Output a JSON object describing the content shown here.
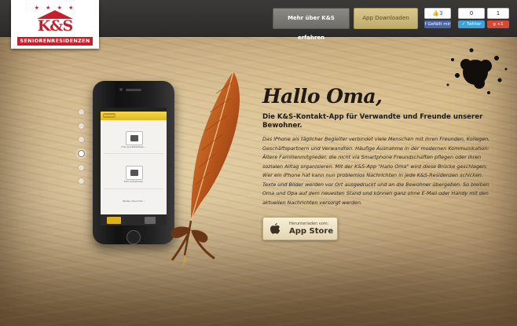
{
  "header": {
    "logo": {
      "mark": "K&S",
      "subtitle": "SENIORENRESIDENZEN",
      "stars": "★ ★ ★ ★"
    },
    "more_button": "Mehr über K&S erfahren",
    "app_button": "App Downloaden"
  },
  "social": {
    "facebook": {
      "count": "3",
      "label": "Gefällt mir"
    },
    "twitter": {
      "count": "0",
      "label": "Twitter"
    },
    "google": {
      "count": "1",
      "label": "+1"
    }
  },
  "slider": {
    "dots": 6,
    "active_index": 3
  },
  "phone_screen": {
    "back": "Startseite",
    "tile1_caption": "Foto aus Bibliothek...",
    "tile2_caption": "Foto aufnehmen",
    "footer_caption": "Weiter ohne Foto ›",
    "tab1": "Nachricht",
    "tab2": "Info"
  },
  "hero": {
    "title": "Hallo Oma,",
    "lead": "Die K&S-Kontakt-App für Verwandte und Freunde unserer Bewohner.",
    "body": "Das iPhone als täglicher Begleiter verbindet viele Menschen mit ihren Freunden, Kollegen, Geschäftspartnern und Verwandten. Häufige Ausnahme in der modernen Kommunikation: Ältere Familienmitglieder, die nicht via Smartphone Freundschaften pflegen oder ihren sozialen Alltag organisieren. Mit der K&S-App \"Hallo Oma\" wird diese Brücke geschlagen: Wer ein iPhone hat kann nun problemlos Nachrichten in jede K&S-Residenzen schicken. Texte und Bilder werden vor Ort ausgedruckt und an die Bewohner übergeben. So bleiben Oma und Opa auf dem neuesten Stand und können ganz ohne E-Mail oder Handy mit den aktuellen Nachrichten versorgt werden."
  },
  "appstore": {
    "small": "Herunterladen vom:",
    "big": "App Store"
  },
  "colors": {
    "brand_red": "#c8202a",
    "gold": "#d9c88e",
    "topbar": "#33312e"
  }
}
